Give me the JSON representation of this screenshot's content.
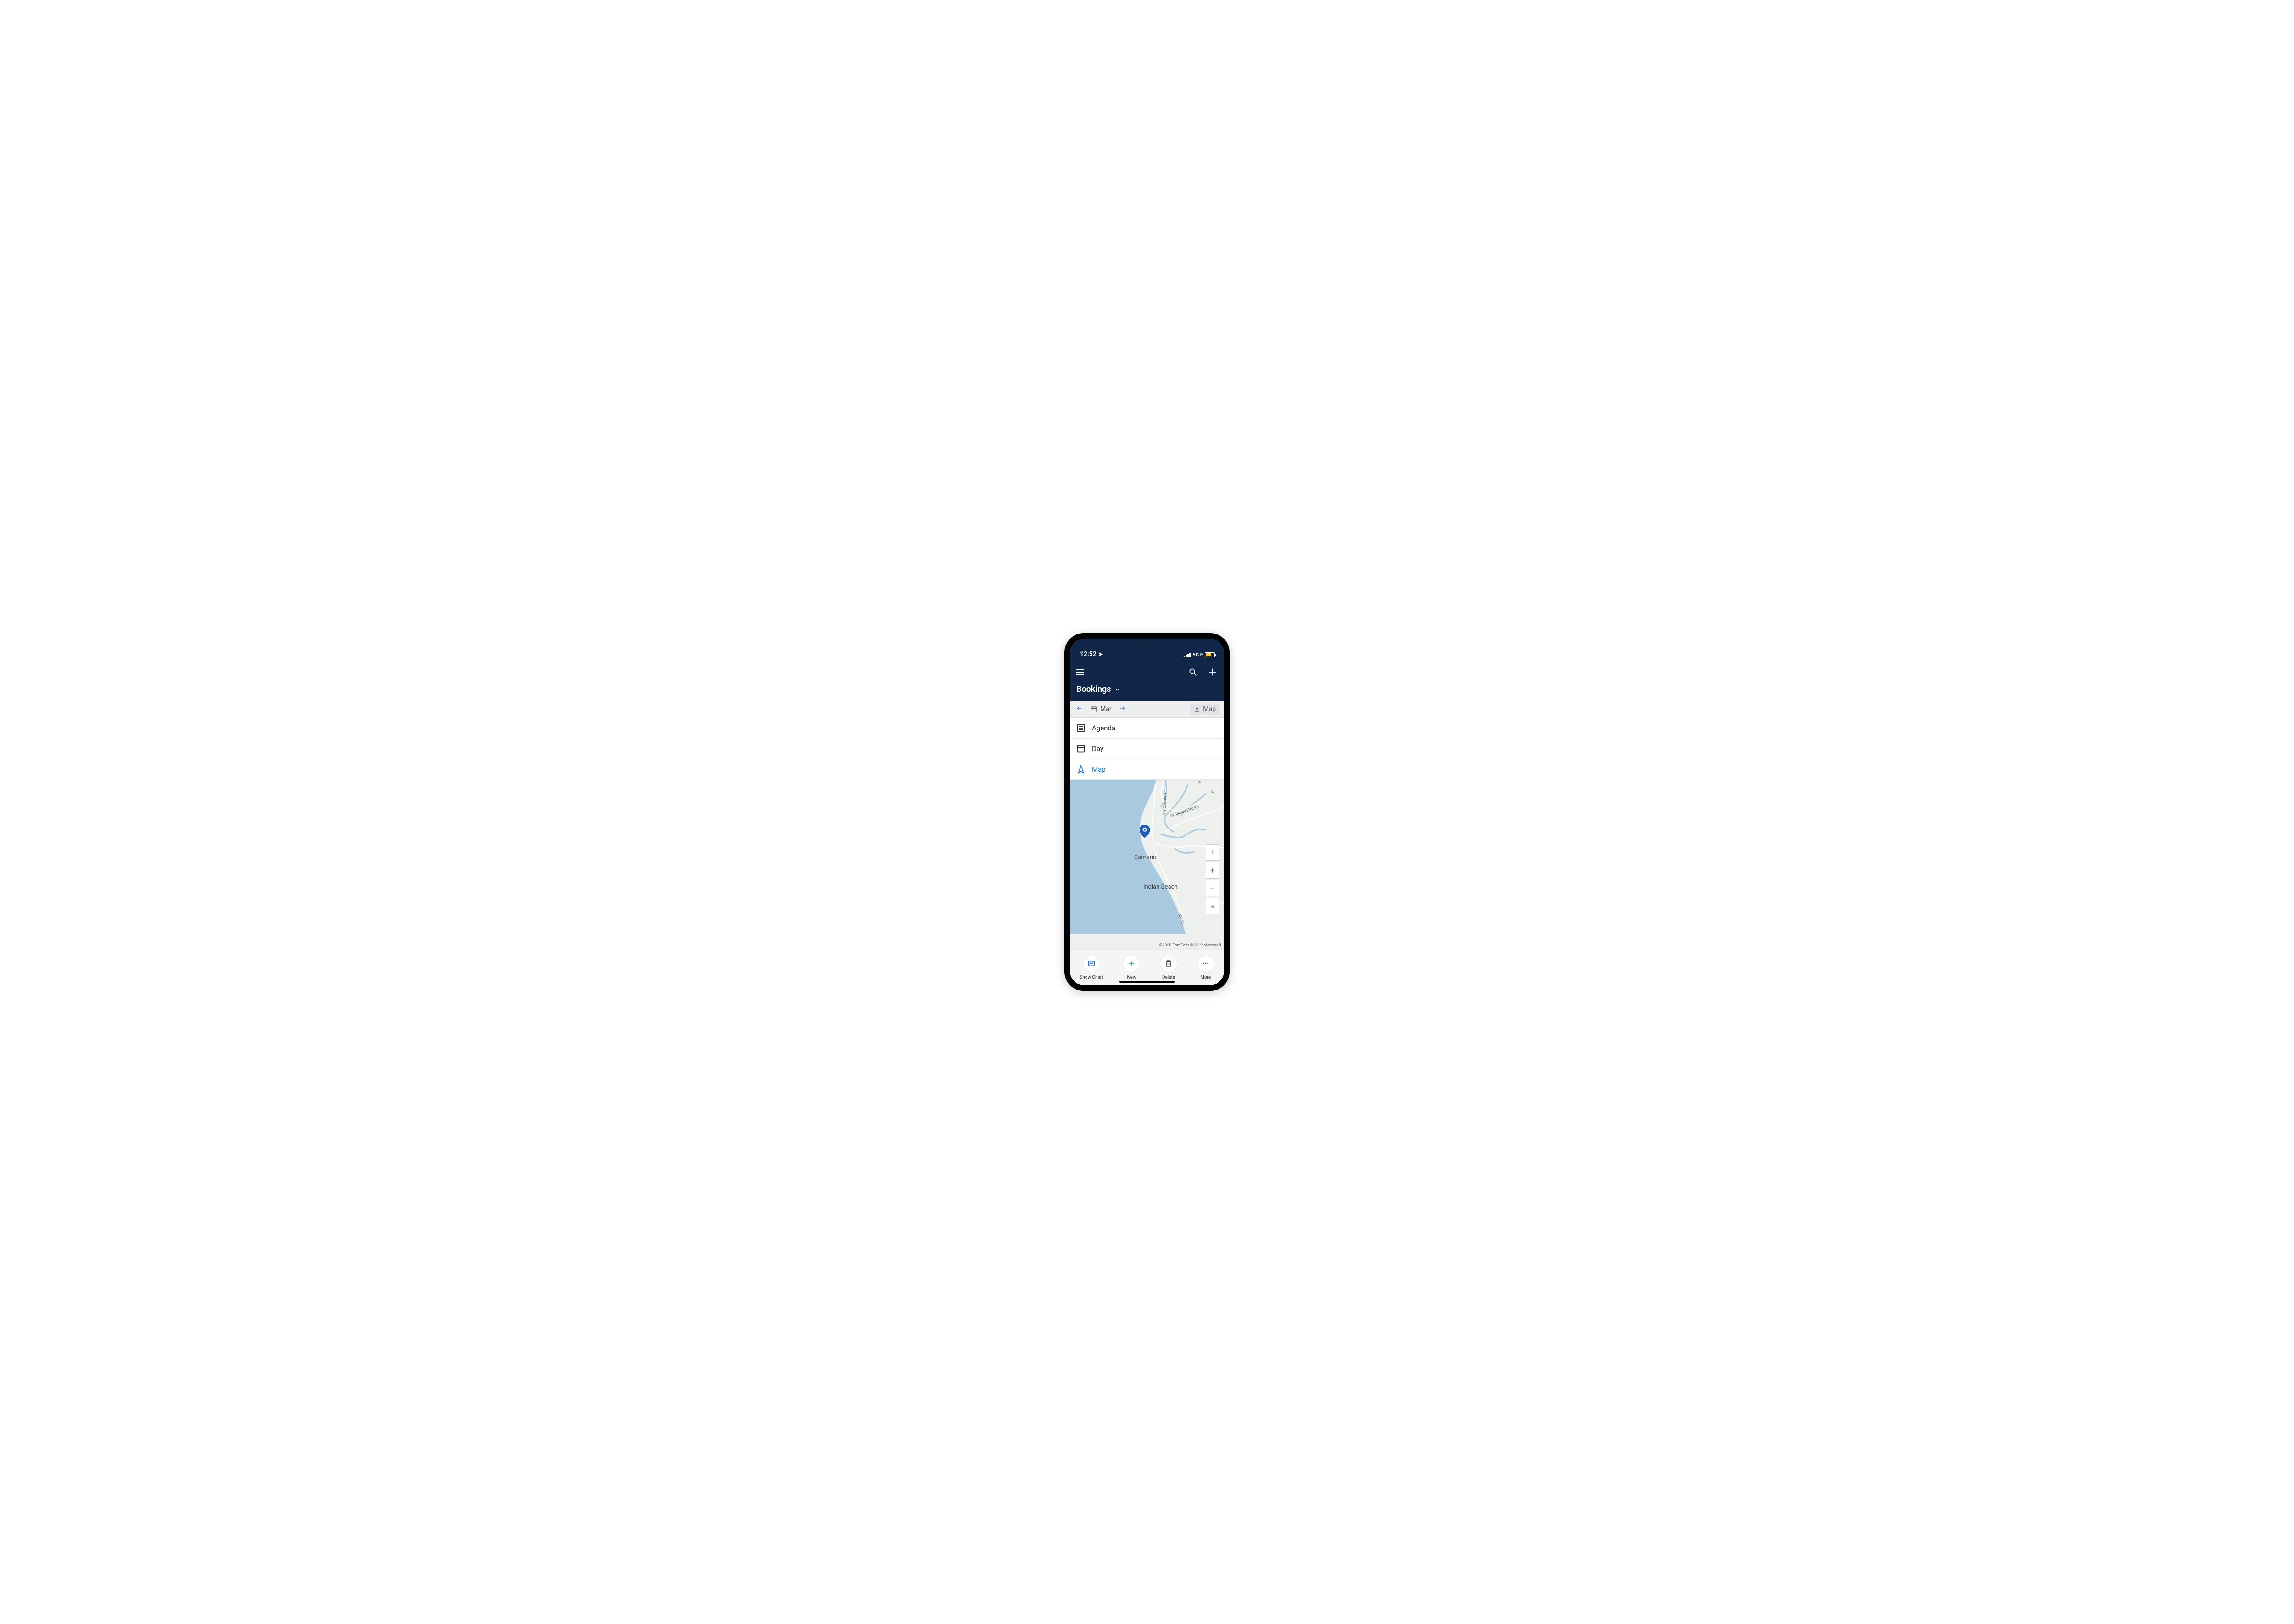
{
  "status": {
    "time": "12:52",
    "network": "5G E"
  },
  "header": {
    "title": "Bookings"
  },
  "datebar": {
    "month": "Mar",
    "map_label": "Map"
  },
  "views": {
    "agenda": "Agenda",
    "day": "Day",
    "map": "Map"
  },
  "map": {
    "city1": "Camano",
    "city2": "Indian Beach",
    "road1": "SW Camano Dr",
    "road2": "W Camano Hill Rd",
    "road3": "SW Ca",
    "road4": "W Mo",
    "road5": "Ch",
    "road6": "P",
    "attribution": "©2020 TomTom ©2019 Microsoft"
  },
  "actions": {
    "chart": "Show Chart",
    "new": "New",
    "delete": "Delete",
    "more": "More"
  }
}
